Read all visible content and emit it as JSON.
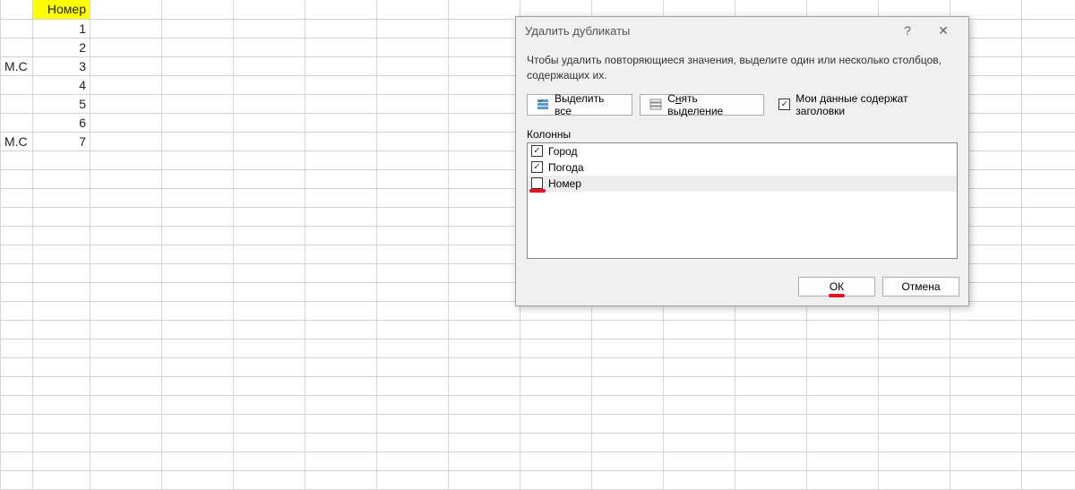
{
  "sheet": {
    "header": "Номер",
    "rows": [
      {
        "a": "",
        "b": "1"
      },
      {
        "a": "",
        "b": "2"
      },
      {
        "a": "М.С",
        "b": "3"
      },
      {
        "a": "",
        "b": "4"
      },
      {
        "a": "",
        "b": "5"
      },
      {
        "a": "",
        "b": "6"
      },
      {
        "a": "М.С",
        "b": "7"
      }
    ]
  },
  "dialog": {
    "title": "Удалить дубликаты",
    "help_symbol": "?",
    "close_symbol": "✕",
    "instruction": "Чтобы удалить повторяющиеся значения, выделите один или несколько столбцов, содержащих их.",
    "select_all": "Выделить все",
    "unselect_all_pre": "С",
    "unselect_all_accel": "н",
    "unselect_all_post": "ять выделение",
    "headers_checkbox": "Мои данные содержат заголовки",
    "columns_label": "Колонны",
    "columns": [
      {
        "label": "Город",
        "checked": true,
        "selected": false
      },
      {
        "label": "Погода",
        "checked": true,
        "selected": false
      },
      {
        "label": "Номер",
        "checked": false,
        "selected": true
      }
    ],
    "ok": "ОК",
    "cancel": "Отмена"
  }
}
